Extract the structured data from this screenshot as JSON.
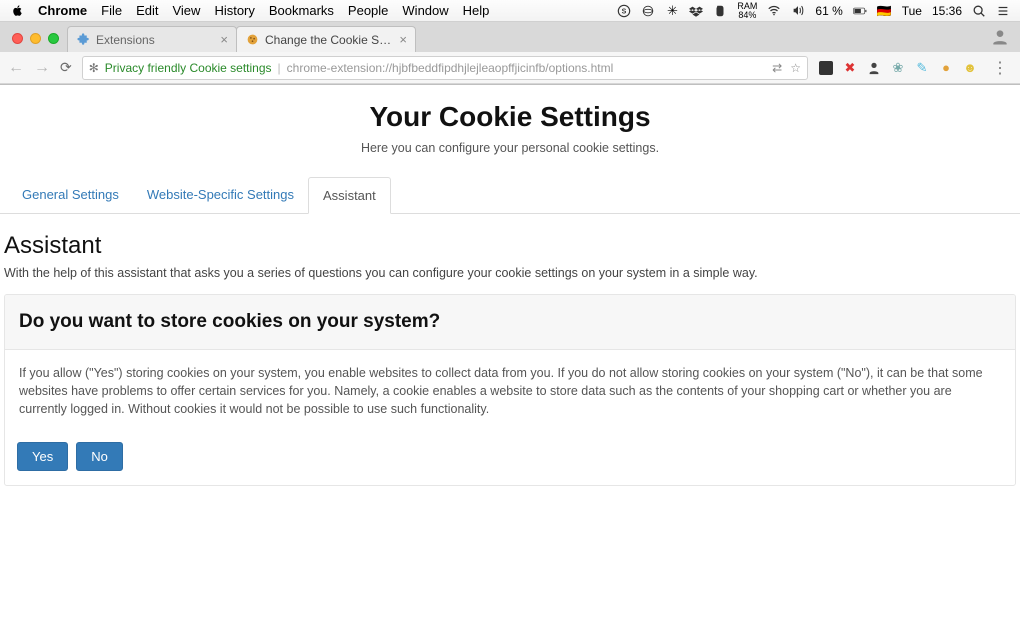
{
  "mac_menu": {
    "app": "Chrome",
    "items": [
      "File",
      "Edit",
      "View",
      "History",
      "Bookmarks",
      "People",
      "Window",
      "Help"
    ],
    "status": {
      "battery_text": "84%",
      "battery_pct_label": "61 %",
      "flag": "🇩🇪",
      "day": "Tue",
      "time": "15:36"
    }
  },
  "browser": {
    "tabs": [
      {
        "title": "Extensions",
        "active": false
      },
      {
        "title": "Change the Cookie Settings",
        "active": true
      }
    ],
    "omnibox": {
      "security_label": "Privacy friendly Cookie settings",
      "url": "chrome-extension://hjbfbeddfipdhjlejleaopffjicinfb/options.html"
    }
  },
  "page": {
    "title": "Your Cookie Settings",
    "subtitle": "Here you can configure your personal cookie settings.",
    "tabs": {
      "general": "General Settings",
      "website": "Website-Specific Settings",
      "assistant": "Assistant"
    },
    "section_heading": "Assistant",
    "section_lead": "With the help of this assistant that asks you a series of questions you can configure your cookie settings on your system in a simple way.",
    "question": {
      "heading": "Do you want to store cookies on your system?",
      "body": "If you allow (\"Yes\") storing cookies on your system, you enable websites to collect data from you. If you do not allow storing cookies on your system (\"No\"), it can be that some websites have problems to offer certain services for you. Namely, a cookie enables a website to store data such as the contents of your shopping cart or whether you are currently logged in. Without cookies it would not be possible to use such functionality.",
      "yes": "Yes",
      "no": "No"
    }
  }
}
